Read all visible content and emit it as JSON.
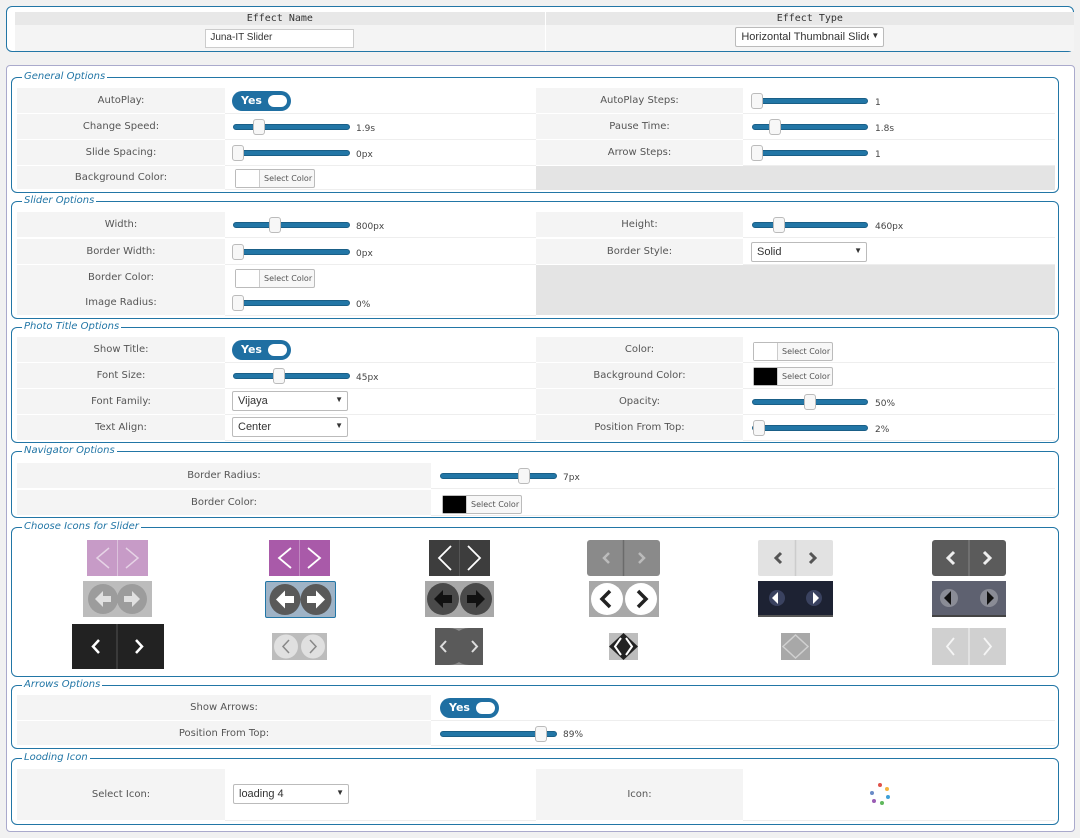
{
  "effect": {
    "name_header": "Effect Name",
    "type_header": "Effect Type",
    "name_value": "Juna-IT Slider",
    "type_value": "Horizontal Thumbnail Slide"
  },
  "general": {
    "legend": "General Options",
    "autoplay_label": "AutoPlay:",
    "autoplay_value": "Yes",
    "autoplay_steps_label": "AutoPlay Steps:",
    "autoplay_steps_value": "1",
    "change_speed_label": "Change Speed:",
    "change_speed_value": "1.9s",
    "pause_time_label": "Pause Time:",
    "pause_time_value": "1.8s",
    "slide_spacing_label": "Slide Spacing:",
    "slide_spacing_value": "0px",
    "arrow_steps_label": "Arrow Steps:",
    "arrow_steps_value": "1",
    "bg_color_label": "Background Color:",
    "select_color": "Select Color"
  },
  "slider": {
    "legend": "Slider Options",
    "width_label": "Width:",
    "width_value": "800px",
    "height_label": "Height:",
    "height_value": "460px",
    "border_width_label": "Border Width:",
    "border_width_value": "0px",
    "border_style_label": "Border Style:",
    "border_style_value": "Solid",
    "border_color_label": "Border Color:",
    "select_color": "Select Color",
    "image_radius_label": "Image Radius:",
    "image_radius_value": "0%"
  },
  "photo_title": {
    "legend": "Photo Title Options",
    "show_title_label": "Show Title:",
    "show_title_value": "Yes",
    "color_label": "Color:",
    "select_color": "Select Color",
    "font_size_label": "Font Size:",
    "font_size_value": "45px",
    "bg_color_label": "Background Color:",
    "select_color_2": "Select Color",
    "font_family_label": "Font Family:",
    "font_family_value": "Vijaya",
    "opacity_label": "Opacity:",
    "opacity_value": "50%",
    "text_align_label": "Text Align:",
    "text_align_value": "Center",
    "pos_top_label": "Position From Top:",
    "pos_top_value": "2%"
  },
  "navigator": {
    "legend": "Navigator Options",
    "border_radius_label": "Border Radius:",
    "border_radius_value": "7px",
    "border_color_label": "Border Color:",
    "select_color": "Select Color"
  },
  "icons": {
    "legend": "Choose Icons for Slider"
  },
  "arrows": {
    "legend": "Arrows Options",
    "show_label": "Show Arrows:",
    "show_value": "Yes",
    "pos_label": "Position From Top:",
    "pos_value": "89%"
  },
  "loading": {
    "legend": "Looding Icon",
    "select_label": "Select Icon:",
    "select_value": "loading 4",
    "icon_label": "Icon:"
  },
  "colors": {
    "accent": "#2276a6",
    "toggle": "#1f6fa2",
    "purple": "#a95aa9",
    "light_purple": "#c79bc7"
  },
  "levels": {
    "change_speed": 0.2,
    "pause_time": 0.18,
    "width": 0.33,
    "height": 0.22,
    "font_size": 0.38,
    "opacity": 0.5,
    "pos_top_title": 0.02,
    "nav_radius": 0.7,
    "arrow_pos": 0.89
  }
}
